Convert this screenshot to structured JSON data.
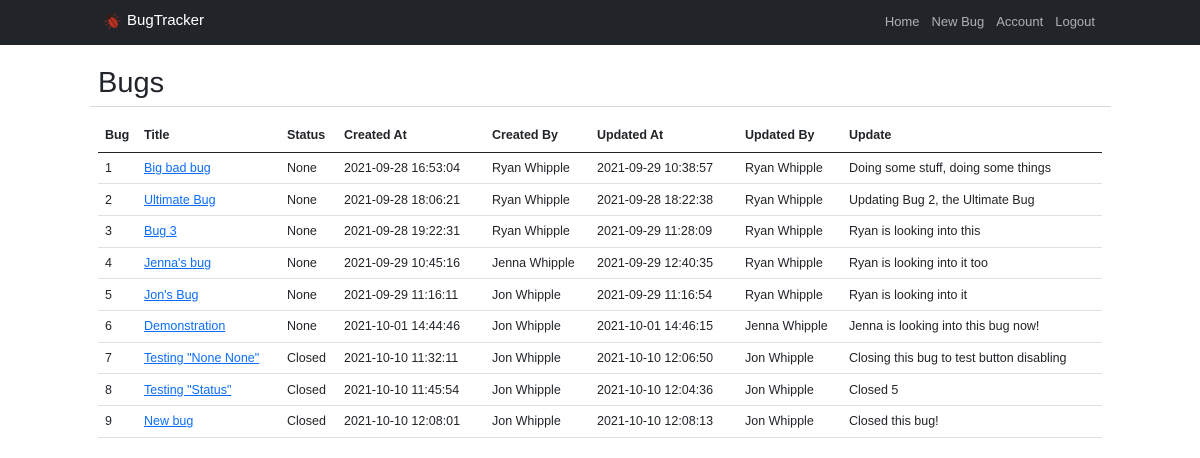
{
  "navbar": {
    "brand": "BugTracker",
    "brand_icon": "bug-icon",
    "links": [
      "Home",
      "New Bug",
      "Account",
      "Logout"
    ],
    "background": "#212529"
  },
  "page": {
    "title": "Bugs"
  },
  "table": {
    "headers": [
      "Bug",
      "Title",
      "Status",
      "Created At",
      "Created By",
      "Updated At",
      "Updated By",
      "Update"
    ],
    "rows": [
      [
        "1",
        "Big bad bug",
        "None",
        "2021-09-28 16:53:04",
        "Ryan Whipple",
        "2021-09-29 10:38:57",
        "Ryan Whipple",
        "Doing some stuff, doing some things"
      ],
      [
        "2",
        "Ultimate Bug",
        "None",
        "2021-09-28 18:06:21",
        "Ryan Whipple",
        "2021-09-28 18:22:38",
        "Ryan Whipple",
        "Updating Bug 2, the Ultimate Bug"
      ],
      [
        "3",
        "Bug 3",
        "None",
        "2021-09-28 19:22:31",
        "Ryan Whipple",
        "2021-09-29 11:28:09",
        "Ryan Whipple",
        "Ryan is looking into this"
      ],
      [
        "4",
        "Jenna's bug",
        "None",
        "2021-09-29 10:45:16",
        "Jenna Whipple",
        "2021-09-29 12:40:35",
        "Ryan Whipple",
        "Ryan is looking into it too"
      ],
      [
        "5",
        "Jon's Bug",
        "None",
        "2021-09-29 11:16:11",
        "Jon Whipple",
        "2021-09-29 11:16:54",
        "Ryan Whipple",
        "Ryan is looking into it"
      ],
      [
        "6",
        "Demonstration",
        "None",
        "2021-10-01 14:44:46",
        "Jon Whipple",
        "2021-10-01 14:46:15",
        "Jenna Whipple",
        "Jenna is looking into this bug now!"
      ],
      [
        "7",
        "Testing \"None None\"",
        "Closed",
        "2021-10-10 11:32:11",
        "Jon Whipple",
        "2021-10-10 12:06:50",
        "Jon Whipple",
        "Closing this bug to test button disabling"
      ],
      [
        "8",
        "Testing \"Status\"",
        "Closed",
        "2021-10-10 11:45:54",
        "Jon Whipple",
        "2021-10-10 12:04:36",
        "Jon Whipple",
        "Closed 5"
      ],
      [
        "9",
        "New bug",
        "Closed",
        "2021-10-10 12:08:01",
        "Jon Whipple",
        "2021-10-10 12:08:13",
        "Jon Whipple",
        "Closed this bug!"
      ]
    ],
    "link_color": "#0d6efd"
  }
}
